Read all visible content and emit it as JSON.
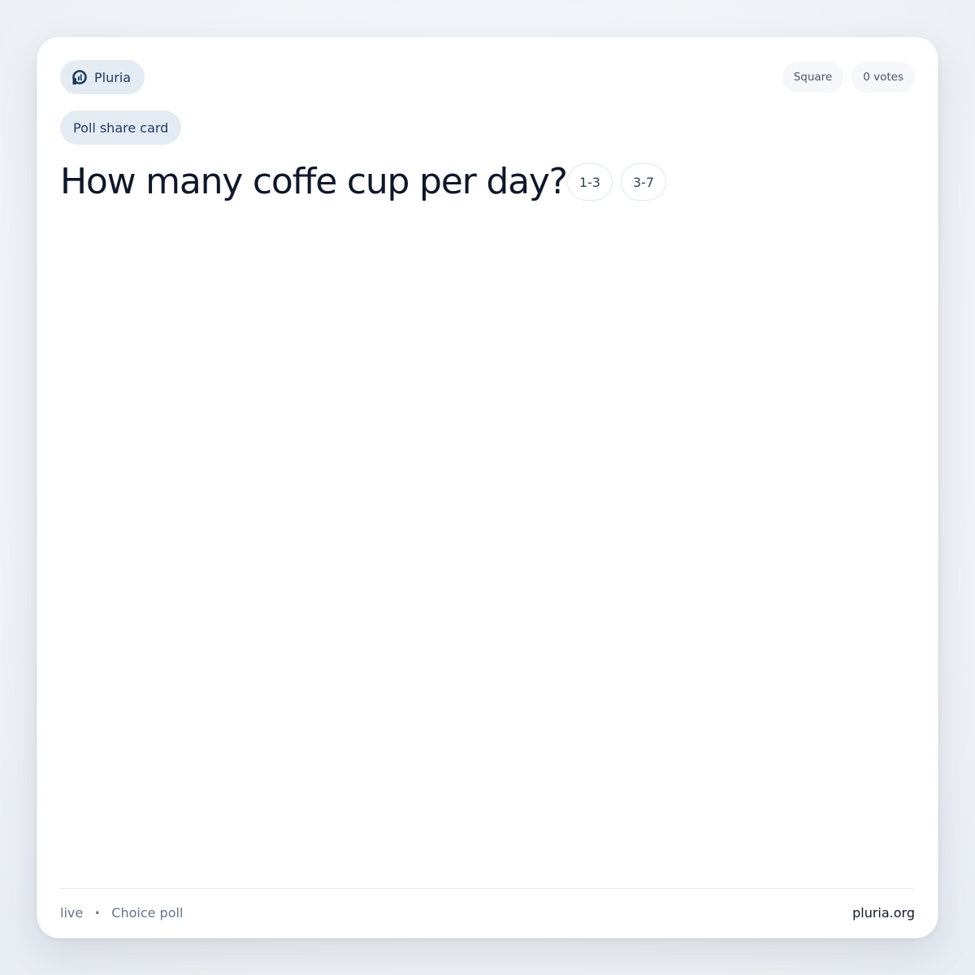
{
  "brand": {
    "name": "Pluria",
    "icon": "pluria-logo-icon"
  },
  "meta": {
    "format_label": "Square",
    "votes_label": "0 votes"
  },
  "card_type": "Poll share card",
  "poll": {
    "question": "How many coffe cup per day?",
    "options": [
      "1-3",
      "3-7"
    ]
  },
  "footer": {
    "status": "live",
    "separator": "•",
    "poll_type": "Choice poll",
    "site": "pluria.org"
  },
  "colors": {
    "accent": "#1e3a5f",
    "pill_background": "#e4ebf3",
    "text_primary": "#0f172a",
    "text_muted": "#64748b"
  }
}
